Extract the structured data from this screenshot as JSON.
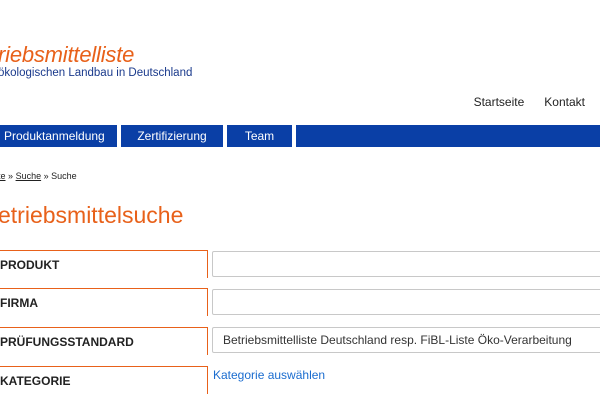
{
  "logo": {
    "title": "riebsmittelliste",
    "subtitle": "ökologischen Landbau in Deutschland"
  },
  "top_nav": [
    "Startseite",
    "Kontakt"
  ],
  "main_nav": [
    "Produktanmeldung",
    "Zertifizierung",
    "Team"
  ],
  "breadcrumb": {
    "items": [
      "ite",
      "Suche",
      "Suche"
    ],
    "separator": "»"
  },
  "page_title": "etriebsmittelsuche",
  "form": {
    "product_label": "PRODUKT",
    "product_value": "",
    "company_label": "FIRMA",
    "company_value": "",
    "standard_label": "PRÜFUNGSSTANDARD",
    "standard_value": "Betriebsmittelliste Deutschland resp. FiBL-Liste Öko-Verarbeitung",
    "category_label": "KATEGORIE",
    "category_link": "Kategorie auswählen"
  },
  "colors": {
    "accent_orange": "#e8611a",
    "nav_blue": "#0a3fa6",
    "logo_blue": "#1a3a8c",
    "link_blue": "#1a6ccf"
  }
}
